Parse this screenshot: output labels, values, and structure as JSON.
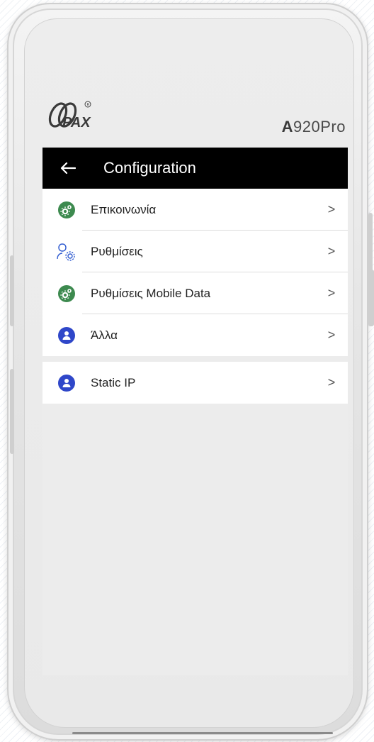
{
  "brand": {
    "logo_text": "PAX",
    "model_prefix": "A",
    "model_suffix": "920Pro"
  },
  "appbar": {
    "back_icon": "arrow-left-icon",
    "title": "Configuration"
  },
  "menu": {
    "items": [
      {
        "label": "Επικοινωνία",
        "icon": "gear-circle-icon",
        "color": "#3d8a4f"
      },
      {
        "label": "Ρυθμίσεις",
        "icon": "user-settings-icon",
        "color": "#2f5bd0"
      },
      {
        "label": "Ρυθμίσεις Mobile Data",
        "icon": "gear-circle-icon",
        "color": "#3d8a4f"
      },
      {
        "label": "Άλλα",
        "icon": "user-circle-icon",
        "color": "#2f47c9"
      }
    ],
    "group2": [
      {
        "label": "Static IP",
        "icon": "user-circle-icon",
        "color": "#2f47c9"
      }
    ],
    "chevron": ">"
  },
  "colors": {
    "appbar_bg": "#000000",
    "screen_bg": "#ececec"
  }
}
